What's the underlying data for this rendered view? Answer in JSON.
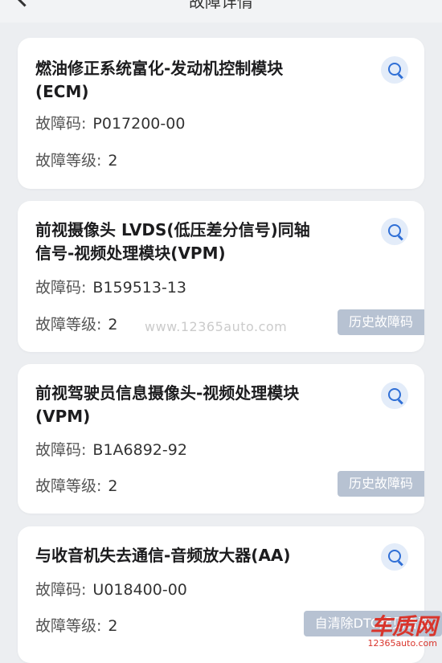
{
  "header": {
    "title": "故障详情"
  },
  "labels": {
    "code": "故障码:",
    "level": "故障等级:"
  },
  "cards": [
    {
      "name_line1": "燃油修正系统富化-发动机控制模块",
      "name_line2": "(ECM)",
      "code": "P017200-00",
      "level": "2",
      "tag": ""
    },
    {
      "name_line1": "前视摄像头 LVDS(低压差分信号)同轴",
      "name_line2": "信号-视频处理模块(VPM)",
      "code": "B159513-13",
      "level": "2",
      "tag": "历史故障码"
    },
    {
      "name_line1": "前视驾驶员信息摄像头-视频处理模块",
      "name_line2": "(VPM)",
      "code": "B1A6892-92",
      "level": "2",
      "tag": "历史故障码"
    },
    {
      "name_line1": "与收音机失去通信-音频放大器(AA)",
      "name_line2": "",
      "code": "U018400-00",
      "level": "2",
      "tag": "自清除DTC起见告警"
    }
  ],
  "watermark": "www.12365auto.com",
  "logo": {
    "title": "车质网",
    "url": "12365auto.com"
  },
  "colors": {
    "accent": "#2f6fd6",
    "tag_bg": "#b7c2d2",
    "page_bg": "#eceef1",
    "logo_red": "#d9342b"
  }
}
